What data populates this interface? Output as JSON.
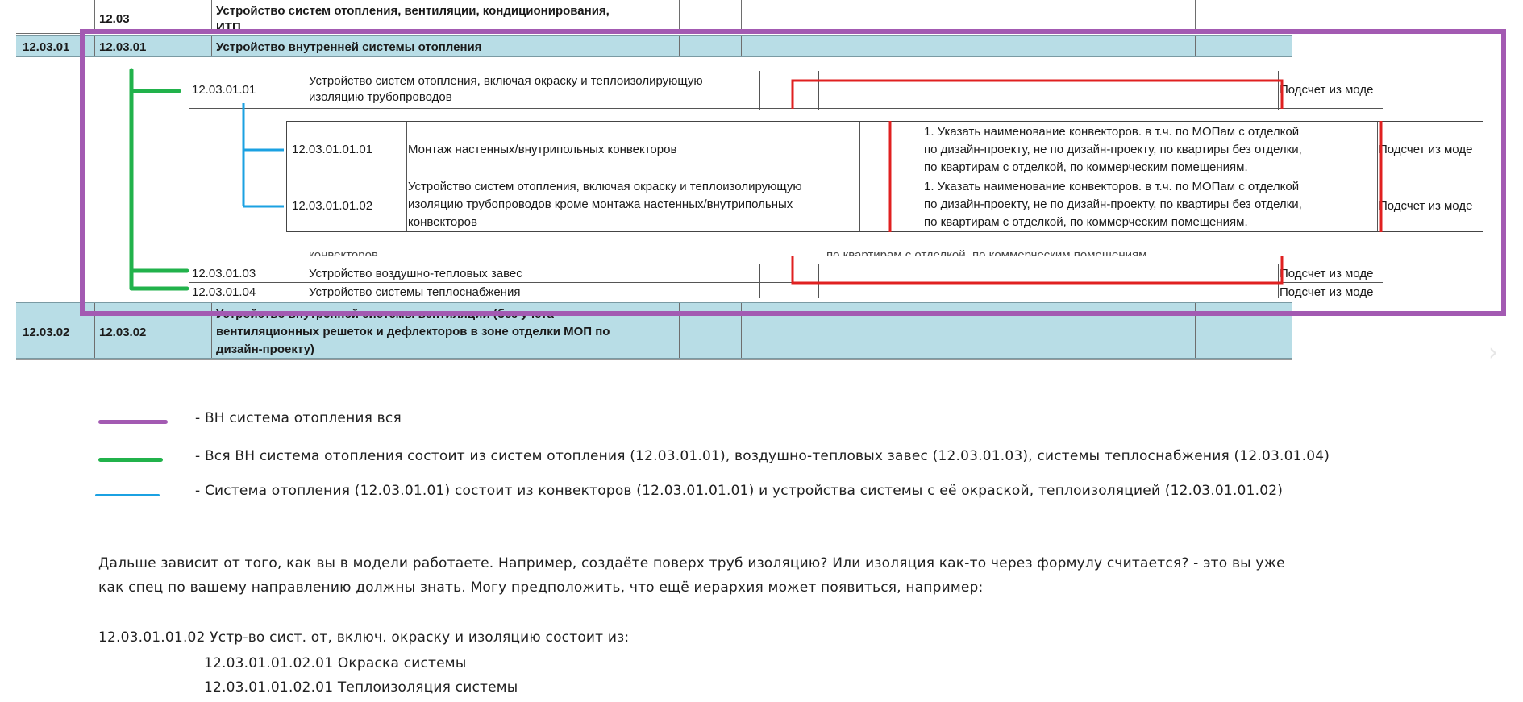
{
  "colors": {
    "purple": "#a35ab2",
    "green": "#21b24b",
    "blue": "#1ba1e2",
    "red": "#e02020",
    "header_blue": "#b8dde6"
  },
  "table": {
    "top_row": {
      "code": "12.03",
      "title_line1": "Устройство систем отопления, вентиляции, кондиционирования,",
      "title_line2": "ИТП"
    },
    "row_1203_01": {
      "code_a": "12.03.01",
      "code_b": "12.03.01",
      "title": "Устройство внутренней системы отопления"
    },
    "item_01": {
      "code": "12.03.01.01",
      "title_line1": "Устройство систем отопления, включая окраску и теплоизолирующую",
      "title_line2": "изоляцию трубопроводов",
      "method": "Подсчет из моде"
    },
    "sub_01": {
      "code": "12.03.01.01.01",
      "title": "Монтаж настенных/внутрипольных конвекторов",
      "note_line1": "1.  Указать наименование конвекторов. в т.ч. по МОПам с отделкой",
      "note_line2": "по  дизайн-проекту, не по дизайн-проекту, по квартиры без отделки,",
      "note_line3": "по квартирам с отделкой, по коммерческим помещениям.",
      "method": "Подсчет из моде"
    },
    "sub_02": {
      "code": "12.03.01.01.02",
      "title_line1": "Устройство систем отопления, включая окраску и теплоизолирующую",
      "title_line2": "изоляцию трубопроводов кроме монтажа настенных/внутрипольных",
      "title_line3": "конвекторов",
      "note_line1": "1.  Указать наименование конвекторов. в т.ч. по МОПам с отделкой",
      "note_line2": "по  дизайн-проекту, не по дизайн-проекту, по квартиры без отделки,",
      "note_line3": "по квартирам с отделкой, по коммерческим помещениям.",
      "method": "Подсчет из моде"
    },
    "ghost_left": "конвекторов",
    "ghost_right": "по квартирам с отделкой, по коммерческим помещениям.",
    "item_03": {
      "code": "12.03.01.03",
      "title": "Устройство воздушно-тепловых завес",
      "method": "Подсчет из моде"
    },
    "item_04": {
      "code": "12.03.01.04",
      "title": "Устройство системы теплоснабжения",
      "method": "Подсчет из моде"
    },
    "row_1203_02": {
      "code_a": "12.03.02",
      "code_b": "12.03.02",
      "title_line1": "Устройство внутренней системы вентиляции (без учета",
      "title_line2": "вентиляционных решеток и дефлекторов в зоне отделки МОП по",
      "title_line3": "дизайн-проекту)"
    }
  },
  "legend": [
    {
      "color_name": "purple",
      "text": "- ВН система отопления вся"
    },
    {
      "color_name": "green",
      "text": "- Вся ВН система отопления состоит из систем отопления (12.03.01.01), воздушно-тепловых завес (12.03.01.03), системы теплоснабжения (12.03.01.04)"
    },
    {
      "color_name": "blue",
      "text": "- Система отопления (12.03.01.01) состоит из конвекторов (12.03.01.01.01) и устройства системы с её окраской, теплоизоляцией (12.03.01.01.02)"
    }
  ],
  "notes": {
    "paragraph_line1": "Дальше зависит от того, как вы в модели работаете. Например, создаёте поверх труб изоляцию? Или изоляция как-то через формулу считается? - это вы уже",
    "paragraph_line2": "как спец по вашему направлению должны знать. Могу предположить, что ещё иерархия может появиться, например:",
    "hierarchy_parent": "12.03.01.01.02 Устр-во сист. от, включ. окраску и изоляцию состоит из:",
    "hierarchy_children": [
      "12.03.01.01.02.01 Окраска системы",
      "12.03.01.01.02.01 Теплоизоляция системы"
    ]
  },
  "nav": {
    "next_glyph": "›"
  }
}
